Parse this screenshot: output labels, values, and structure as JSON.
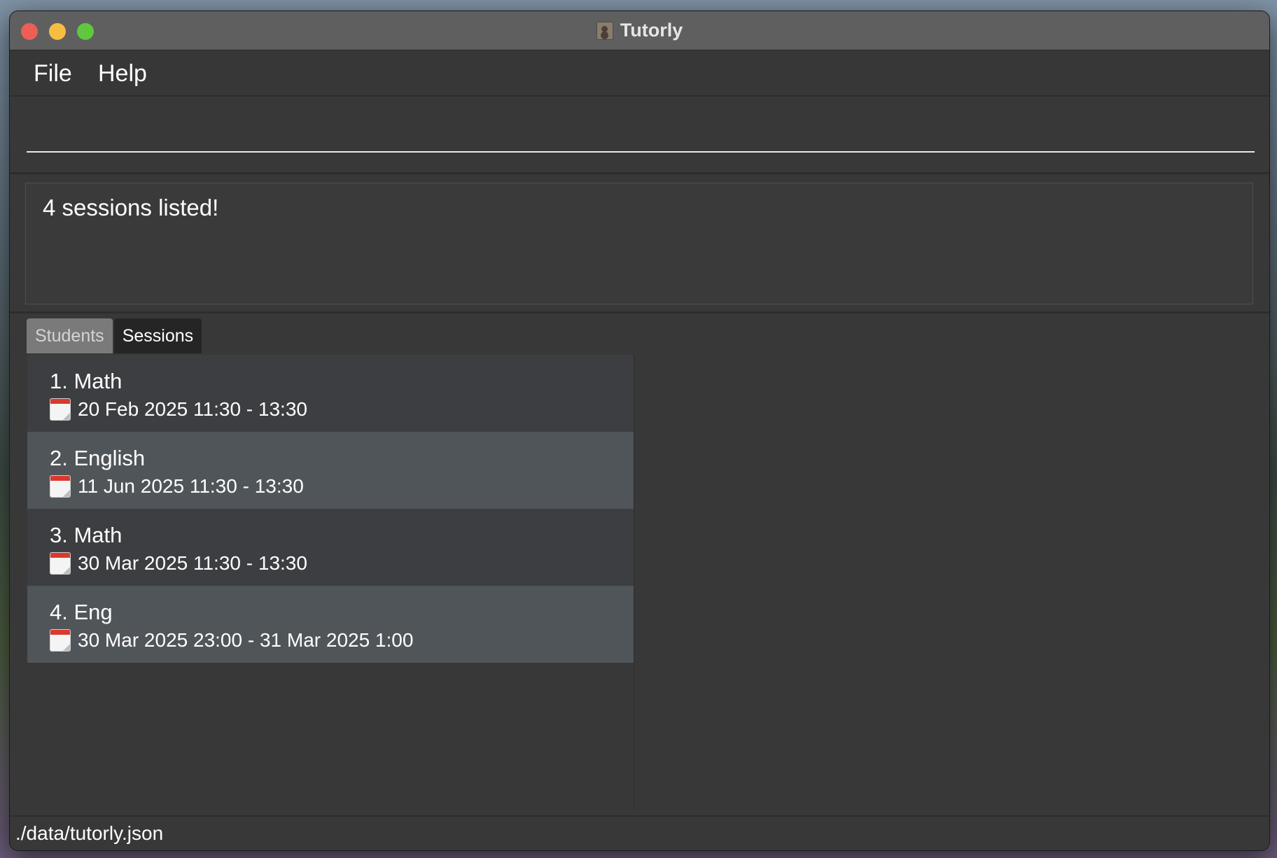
{
  "window": {
    "title": "Tutorly"
  },
  "menu": {
    "file": "File",
    "help": "Help"
  },
  "command": {
    "value": "",
    "placeholder": ""
  },
  "result": {
    "message": "4 sessions listed!"
  },
  "tabs": [
    {
      "label": "Students",
      "active": false
    },
    {
      "label": "Sessions",
      "active": true
    }
  ],
  "sessions": [
    {
      "title": "1. Math",
      "time": "20 Feb 2025 11:30 - 13:30",
      "icon": "calendar-icon"
    },
    {
      "title": "2. English",
      "time": "11 Jun 2025 11:30 - 13:30",
      "icon": "calendar-icon"
    },
    {
      "title": "3. Math",
      "time": "30 Mar 2025 11:30 - 13:30",
      "icon": "calendar-icon"
    },
    {
      "title": "4. Eng",
      "time": "30 Mar 2025 23:00 - 31 Mar 2025 1:00",
      "icon": "calendar-icon"
    }
  ],
  "status": {
    "path": "./data/tutorly.json"
  },
  "colors": {
    "close": "#ec5f57",
    "minimize": "#f5be40",
    "maximize": "#5fc83e",
    "window_bg": "#383838",
    "row_dark": "#3c3e41",
    "row_light": "#505559",
    "tab_active": "#252525",
    "tab_inactive": "#7a7a7a"
  }
}
